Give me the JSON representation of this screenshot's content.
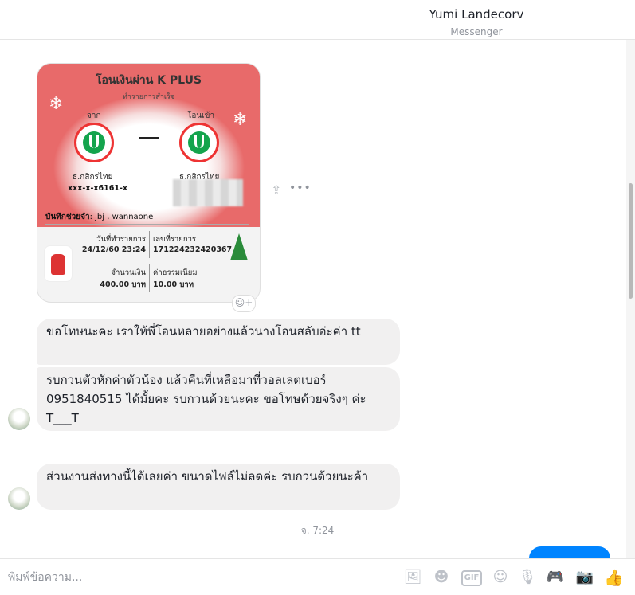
{
  "header": {
    "name": "Yumi Landecorv",
    "subtitle": "Messenger"
  },
  "receipt": {
    "title": "โอนเงินผ่าน K PLUS",
    "status": "ทำรายการสำเร็จ",
    "from_label": "จาก",
    "to_label": "โอนเข้า",
    "from_bank": "ธ.กสิกรไทย",
    "from_account": "xxx-x-x6161-x",
    "to_bank": "ธ.กสิกรไทย",
    "memo_label": "บันทึกช่วยจำ",
    "memo_value": ": jbj , wannaone",
    "date_label": "วันที่ทำรายการ",
    "date_value": "24/12/60 23:24",
    "ref_label": "เลขที่รายการ",
    "ref_value": "171224232420367",
    "amount_label": "จำนวนเงิน",
    "amount_value": "400.00 บาท",
    "fee_label": "ค่าธรรมเนียม",
    "fee_value": "10.00 บาท"
  },
  "messages": [
    {
      "text": "ขอโทษนะคะ เราให้พี่โอนหลายอย่างแล้วนางโอนสลับอ่ะค่า tt"
    },
    {
      "text": "รบกวนตัวหักค่าตัวน้อง แล้วคืนที่เหลือมาที่วอลเลตเบอร์ 0951840515 ได้มั้ยคะ รบกวนด้วยนะคะ ขอโทษด้วยจริงๆ ค่ะ T___T"
    },
    {
      "text": "ส่วนงานส่งทางนี้ได้เลยค่า ขนาดไฟล์ไม่ลดค่ะ รบกวนด้วยนะค้า"
    }
  ],
  "timestamp": "จ. 7:24",
  "composer": {
    "placeholder": "พิมพ์ข้อความ..."
  },
  "icons": {
    "share": "share-icon",
    "more": "more-icon",
    "react": "add-reaction-icon",
    "photo": "photo-icon",
    "sticker": "sticker-icon",
    "gif": "GIF",
    "emoji": "emoji-icon",
    "mic": "microphone-icon",
    "game": "game-controller-icon",
    "camera": "camera-icon",
    "like": "thumbs-up-icon"
  },
  "colors": {
    "accent": "#0084ff",
    "bubble": "#f1f0f0",
    "receipt_red": "#e25c5c"
  }
}
